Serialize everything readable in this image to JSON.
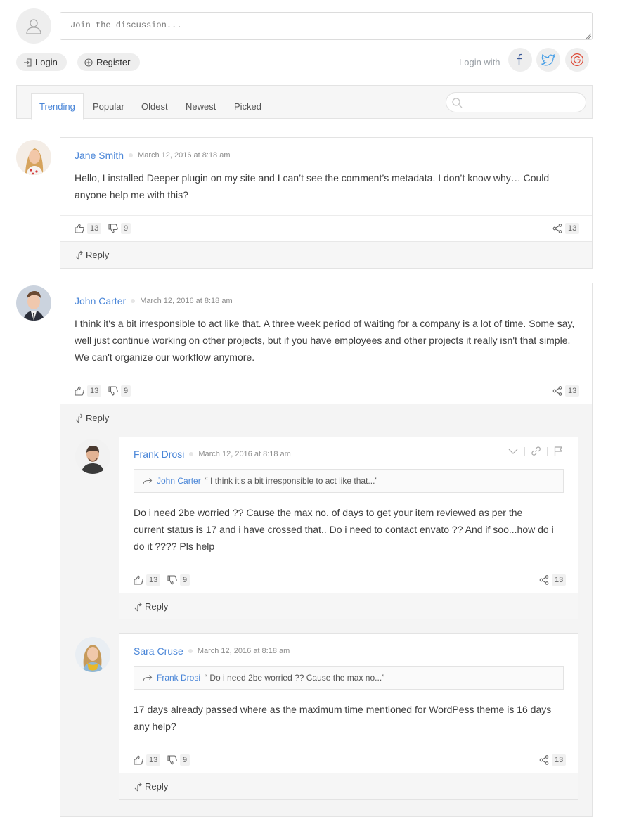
{
  "composer": {
    "placeholder": "Join the discussion...",
    "login_label": "Login",
    "register_label": "Register",
    "login_with_label": "Login with",
    "social_icons": [
      "facebook-icon",
      "twitter-icon",
      "google-icon"
    ]
  },
  "tabs": [
    {
      "label": "Trending",
      "active": true
    },
    {
      "label": "Popular",
      "active": false
    },
    {
      "label": "Oldest",
      "active": false
    },
    {
      "label": "Newest",
      "active": false
    },
    {
      "label": "Picked",
      "active": false
    }
  ],
  "search": {
    "placeholder": ""
  },
  "comments": [
    {
      "author": "Jane Smith",
      "date": "March 12, 2016 at 8:18 am",
      "text": "Hello, I installed Deeper plugin on my site and I can’t see the comment’s metadata. I don’t know why… Could anyone help me with this?",
      "likes": "13",
      "dislikes": "9",
      "shares": "13",
      "reply_label": "Reply"
    },
    {
      "author": "John Carter",
      "date": "March 12, 2016 at 8:18 am",
      "text": "I think it's a bit irresponsible to act like that. A three week period of waiting for a company is a lot of time. Some say, well just continue working on other projects, but if you have employees and other projects it really isn't that simple. We can't organize our workflow anymore.",
      "likes": "13",
      "dislikes": "9",
      "shares": "13",
      "reply_label": "Reply",
      "replies": [
        {
          "author": "Frank Drosi",
          "date": "March 12, 2016 at 8:18 am",
          "quote_author": "John Carter",
          "quote_text": "“ I think it's a bit irresponsible to act like that...”",
          "text": "Do i need 2be worried ?? Cause the max no. of days to get your item reviewed as per the current status is 17 and i have crossed that.. Do i need to contact envato ?? And if soo...how do i do it ???? Pls help",
          "likes": "13",
          "dislikes": "9",
          "shares": "13",
          "reply_label": "Reply"
        },
        {
          "author": "Sara Cruse",
          "date": "March 12, 2016 at 8:18 am",
          "quote_author": "Frank Drosi",
          "quote_text": "“ Do i need 2be worried ?? Cause the max no...”",
          "text": "17 days already passed where as the maximum time mentioned for WordPess theme is 16 days any help?",
          "likes": "13",
          "dislikes": "9",
          "shares": "13",
          "reply_label": "Reply"
        }
      ]
    }
  ],
  "colors": {
    "accent": "#4a86d8",
    "panel": "#f6f6f6",
    "border": "#e3e3e3"
  }
}
